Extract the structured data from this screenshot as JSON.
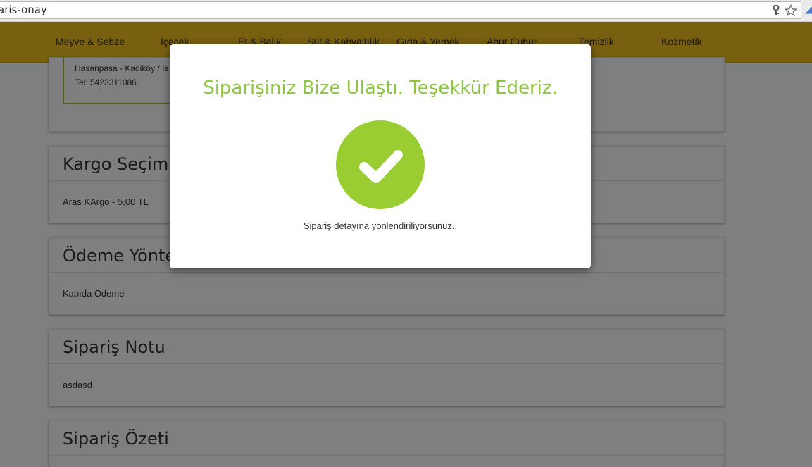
{
  "browser": {
    "address": "aris-onay"
  },
  "nav": {
    "items": [
      {
        "label": "Meyve & Sebze"
      },
      {
        "label": "İçecek"
      },
      {
        "label": "Et & Balık"
      },
      {
        "label": "Süt & Kahvaltılık"
      },
      {
        "label": "Gıda & Yemek"
      },
      {
        "label": "Abur Cubur"
      },
      {
        "label": "Temizlik"
      },
      {
        "label": "Kozmetik"
      }
    ]
  },
  "address_panel": {
    "line1": "Hasanpasa - Kadiköy / Is",
    "line2": "Tel: 5423311086"
  },
  "cargo": {
    "title": "Kargo Seçimi",
    "value": "Aras KArgo - 5,00 TL"
  },
  "payment": {
    "title": "Ödeme Yöntemi",
    "value": "Kapıda Ödeme"
  },
  "note": {
    "title": "Sipariş Notu",
    "value": "asdasd"
  },
  "summary": {
    "title": "Sipariş Özeti"
  },
  "modal": {
    "title": "Siparişiniz Bize Ulaştı. Teşekkür Ederiz.",
    "message": "Sipariş detayına yönlendiriliyorsunuz..",
    "check_icon": "check-icon",
    "accent_color": "#8cc63f"
  }
}
